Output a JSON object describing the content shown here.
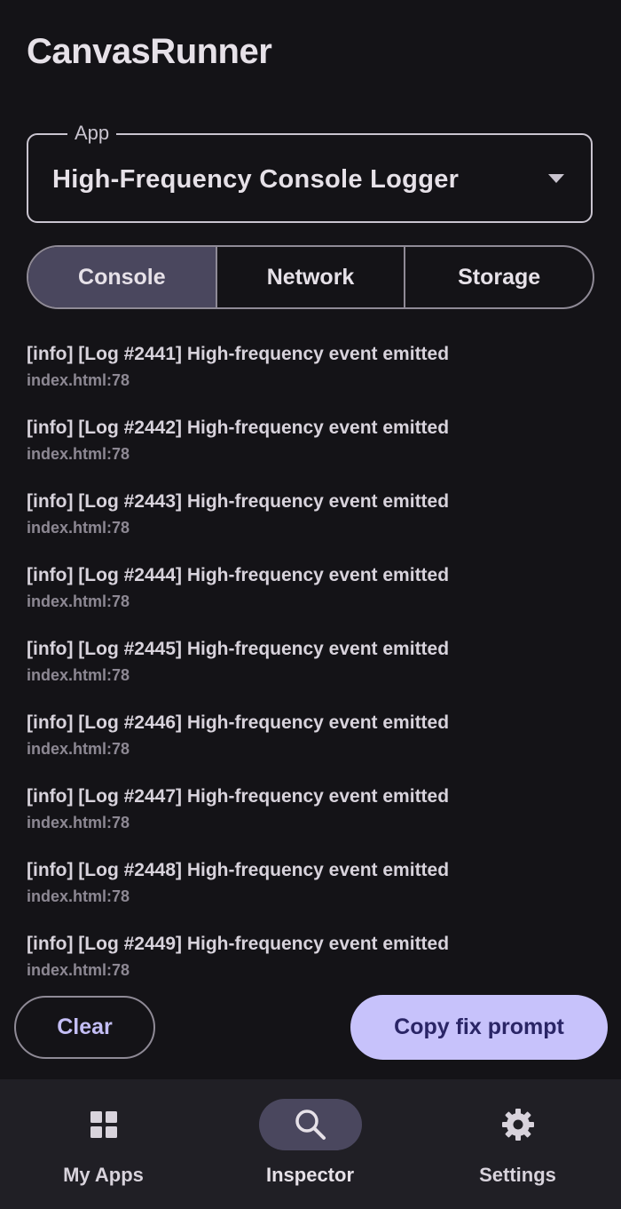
{
  "app": {
    "title": "CanvasRunner"
  },
  "app_select": {
    "label": "App",
    "value": "High-Frequency Console Logger"
  },
  "tabs": [
    {
      "label": "Console",
      "active": true
    },
    {
      "label": "Network",
      "active": false
    },
    {
      "label": "Storage",
      "active": false
    }
  ],
  "console": {
    "entries": [
      {
        "message": "[info] [Log #2441] High-frequency event emitted",
        "source": "index.html:78"
      },
      {
        "message": "[info] [Log #2442] High-frequency event emitted",
        "source": "index.html:78"
      },
      {
        "message": "[info] [Log #2443] High-frequency event emitted",
        "source": "index.html:78"
      },
      {
        "message": "[info] [Log #2444] High-frequency event emitted",
        "source": "index.html:78"
      },
      {
        "message": "[info] [Log #2445] High-frequency event emitted",
        "source": "index.html:78"
      },
      {
        "message": "[info] [Log #2446] High-frequency event emitted",
        "source": "index.html:78"
      },
      {
        "message": "[info] [Log #2447] High-frequency event emitted",
        "source": "index.html:78"
      },
      {
        "message": "[info] [Log #2448] High-frequency event emitted",
        "source": "index.html:78"
      },
      {
        "message": "[info] [Log #2449] High-frequency event emitted",
        "source": "index.html:78"
      }
    ]
  },
  "actions": {
    "clear_label": "Clear",
    "copy_label": "Copy fix prompt"
  },
  "bottom_nav": [
    {
      "label": "My Apps",
      "icon": "grid-icon",
      "active": false
    },
    {
      "label": "Inspector",
      "icon": "search-icon",
      "active": true
    },
    {
      "label": "Settings",
      "icon": "gear-icon",
      "active": false
    }
  ],
  "colors": {
    "background": "#141317",
    "accent": "#c7c2fb",
    "accent_text": "#2a2566",
    "selected_container": "#4a475e",
    "nav_background": "#201f25"
  }
}
